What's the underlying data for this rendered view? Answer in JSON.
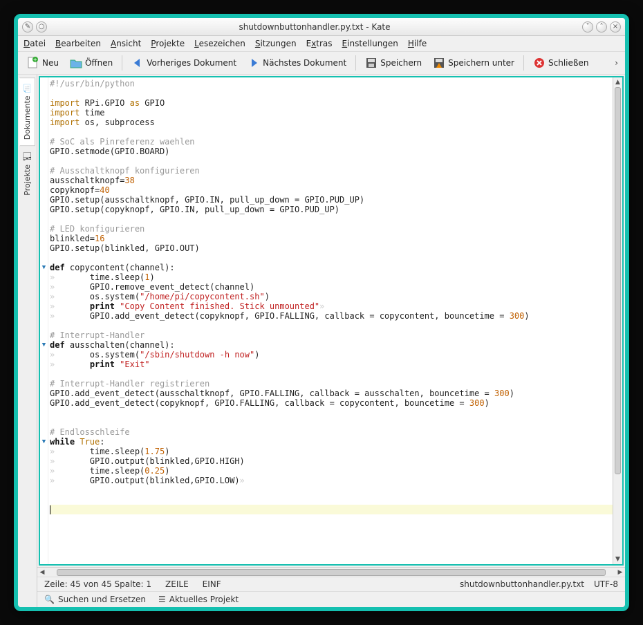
{
  "window": {
    "title": "shutdownbuttonhandler.py.txt - Kate"
  },
  "menu": {
    "items": [
      "Datei",
      "Bearbeiten",
      "Ansicht",
      "Projekte",
      "Lesezeichen",
      "Sitzungen",
      "Extras",
      "Einstellungen",
      "Hilfe"
    ]
  },
  "toolbar": {
    "new": "Neu",
    "open": "Öffnen",
    "prev": "Vorheriges Dokument",
    "next": "Nächstes Dokument",
    "save": "Speichern",
    "saveas": "Speichern unter",
    "close": "Schließen"
  },
  "sidebar": {
    "documents": "Dokumente",
    "projects": "Projekte"
  },
  "status": {
    "pos": "Zeile: 45 von 45 Spalte: 1",
    "linemode": "ZEILE",
    "insert": "EINF",
    "filename": "shutdownbuttonhandler.py.txt",
    "encoding": "UTF-8"
  },
  "bottom": {
    "search": "Suchen und Ersetzen",
    "project": "Aktuelles Projekt"
  },
  "code_lines": [
    {
      "type": "comment",
      "text": "#!/usr/bin/python"
    },
    {
      "type": "blank",
      "text": ""
    },
    {
      "type": "import",
      "text": "import RPi.GPIO as GPIO"
    },
    {
      "type": "import",
      "text": "import time"
    },
    {
      "type": "import",
      "text": "import os, subprocess"
    },
    {
      "type": "blank",
      "text": ""
    },
    {
      "type": "comment",
      "text": "# SoC als Pinreferenz waehlen"
    },
    {
      "type": "plain",
      "text": "GPIO.setmode(GPIO.BOARD)"
    },
    {
      "type": "blank",
      "text": ""
    },
    {
      "type": "comment",
      "text": "# Ausschaltknopf konfigurieren"
    },
    {
      "type": "assign",
      "lhs": "ausschaltknopf=",
      "num": "38"
    },
    {
      "type": "assign",
      "lhs": "copyknopf=",
      "num": "40"
    },
    {
      "type": "plain",
      "text": "GPIO.setup(ausschaltknopf, GPIO.IN, pull_up_down = GPIO.PUD_UP)"
    },
    {
      "type": "plain",
      "text": "GPIO.setup(copyknopf, GPIO.IN, pull_up_down = GPIO.PUD_UP)"
    },
    {
      "type": "blank",
      "text": ""
    },
    {
      "type": "comment",
      "text": "# LED konfigurieren"
    },
    {
      "type": "assign",
      "lhs": "blinkled=",
      "num": "16"
    },
    {
      "type": "plain",
      "text": "GPIO.setup(blinkled, GPIO.OUT)"
    },
    {
      "type": "blank",
      "text": ""
    },
    {
      "type": "def",
      "fold": true,
      "text": "def copycontent(channel):"
    },
    {
      "type": "call",
      "indent": "        ",
      "pre": "time.sleep(",
      "num": "1",
      "post": ")"
    },
    {
      "type": "plaini",
      "indent": "        ",
      "text": "GPIO.remove_event_detect(channel)"
    },
    {
      "type": "callstr",
      "indent": "        ",
      "pre": "os.system(",
      "str": "\"/home/pi/copycontent.sh\"",
      "post": ")"
    },
    {
      "type": "print",
      "indent": "        ",
      "str": "\"Copy Content finished. Stick unmounted\"",
      "tail": true
    },
    {
      "type": "callnum",
      "indent": "        ",
      "pre": "GPIO.add_event_detect(copyknopf, GPIO.FALLING, callback = copycontent, bouncetime = ",
      "num": "300",
      "post": ")"
    },
    {
      "type": "blank",
      "text": ""
    },
    {
      "type": "comment",
      "text": "# Interrupt-Handler"
    },
    {
      "type": "def",
      "fold": true,
      "text": "def ausschalten(channel):"
    },
    {
      "type": "callstr",
      "indent": "        ",
      "pre": "os.system(",
      "str": "\"/sbin/shutdown -h now\"",
      "post": ")"
    },
    {
      "type": "print",
      "indent": "        ",
      "str": "\"Exit\""
    },
    {
      "type": "blank",
      "text": ""
    },
    {
      "type": "comment",
      "text": "# Interrupt-Handler registrieren"
    },
    {
      "type": "callnum",
      "pre": "GPIO.add_event_detect(ausschaltknopf, GPIO.FALLING, callback = ausschalten, bouncetime = ",
      "num": "300",
      "post": ")"
    },
    {
      "type": "callnum",
      "pre": "GPIO.add_event_detect(copyknopf, GPIO.FALLING, callback = copycontent, bouncetime = ",
      "num": "300",
      "post": ")"
    },
    {
      "type": "blank",
      "text": ""
    },
    {
      "type": "blank",
      "text": ""
    },
    {
      "type": "comment",
      "text": "# Endlosschleife"
    },
    {
      "type": "while",
      "fold": true,
      "text": "while True:"
    },
    {
      "type": "call",
      "indent": "        ",
      "pre": "time.sleep(",
      "num": "1.75",
      "post": ")"
    },
    {
      "type": "plaini",
      "indent": "        ",
      "text": "GPIO.output(blinkled,GPIO.HIGH)"
    },
    {
      "type": "call",
      "indent": "        ",
      "pre": "time.sleep(",
      "num": "0.25",
      "post": ")"
    },
    {
      "type": "plaini",
      "indent": "        ",
      "text": "GPIO.output(blinkled,GPIO.LOW)",
      "tail": true
    },
    {
      "type": "blank",
      "text": ""
    },
    {
      "type": "blank",
      "text": ""
    },
    {
      "type": "cursor"
    }
  ]
}
